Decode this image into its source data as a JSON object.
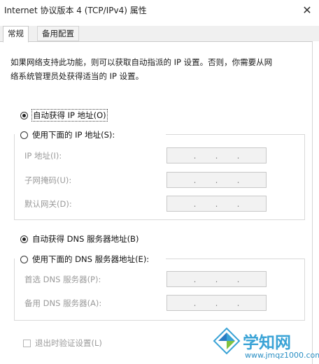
{
  "window": {
    "title": "Internet 协议版本 4 (TCP/IPv4) 属性",
    "close_glyph": "✕"
  },
  "tabs": [
    {
      "label": "常规",
      "active": true
    },
    {
      "label": "备用配置",
      "active": false
    }
  ],
  "description": "如果网络支持此功能，则可以获取自动指派的 IP 设置。否则，你需要从网\n络系统管理员处获得适当的 IP 设置。",
  "ip_mode": {
    "auto": {
      "label": "自动获得 IP 地址(O)",
      "checked": true
    },
    "manual": {
      "label": "使用下面的 IP 地址(S):",
      "checked": false
    },
    "fields": [
      {
        "label": "IP 地址(I):",
        "value": ". . ."
      },
      {
        "label": "子网掩码(U):",
        "value": ". . ."
      },
      {
        "label": "默认网关(D):",
        "value": ". . ."
      }
    ]
  },
  "dns_mode": {
    "auto": {
      "label": "自动获得 DNS 服务器地址(B)",
      "checked": true
    },
    "manual": {
      "label": "使用下面的 DNS 服务器地址(E):",
      "checked": false
    },
    "fields": [
      {
        "label": "首选 DNS 服务器(P):",
        "value": ". . ."
      },
      {
        "label": "备用 DNS 服务器(A):",
        "value": ". . ."
      }
    ]
  },
  "validate_on_exit": {
    "label": "退出时验证设置(L)",
    "checked": false
  },
  "watermark": {
    "text": "学知网",
    "url": "www.jmqz1000.com"
  },
  "colors": {
    "watermark_blue": "#3aa3d6",
    "disabled_text": "#9a9a9a"
  }
}
